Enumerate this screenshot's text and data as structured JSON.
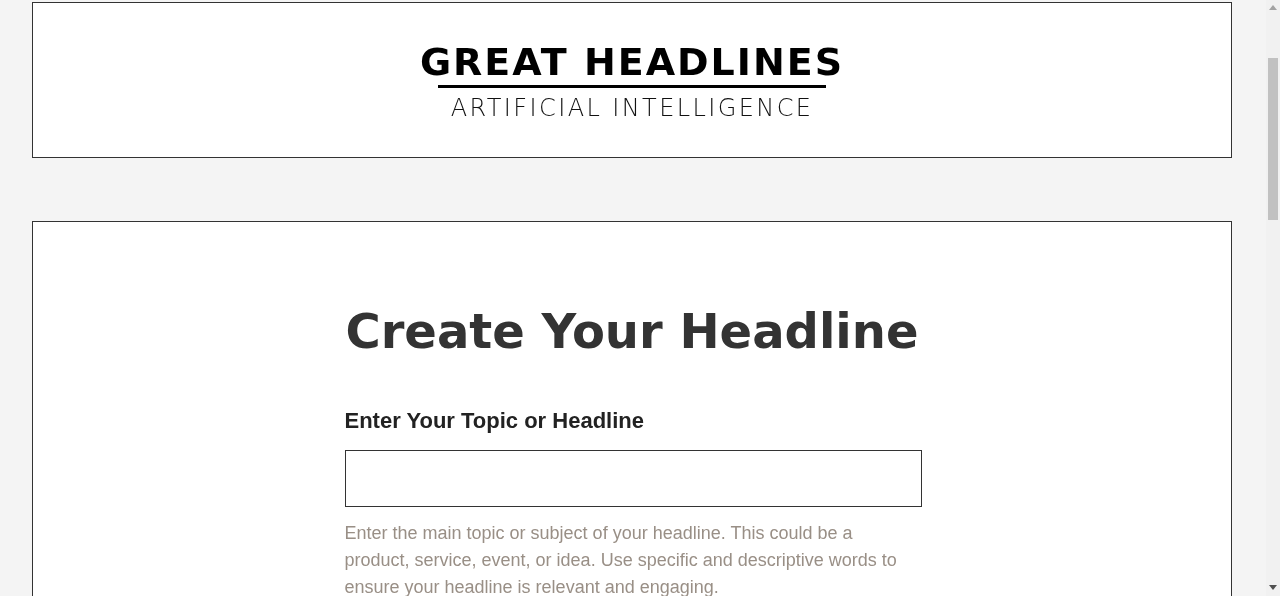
{
  "header": {
    "logo_title": "GREAT HEADLINES",
    "logo_subtitle": "ARTIFICIAL INTELLIGENCE"
  },
  "main": {
    "title": "Create Your Headline",
    "field_label": "Enter Your Topic or Headline",
    "help_text": "Enter the main topic or subject of your headline. This could be a product, service, event, or idea. Use specific and descriptive words to ensure your headline is relevant and engaging."
  }
}
